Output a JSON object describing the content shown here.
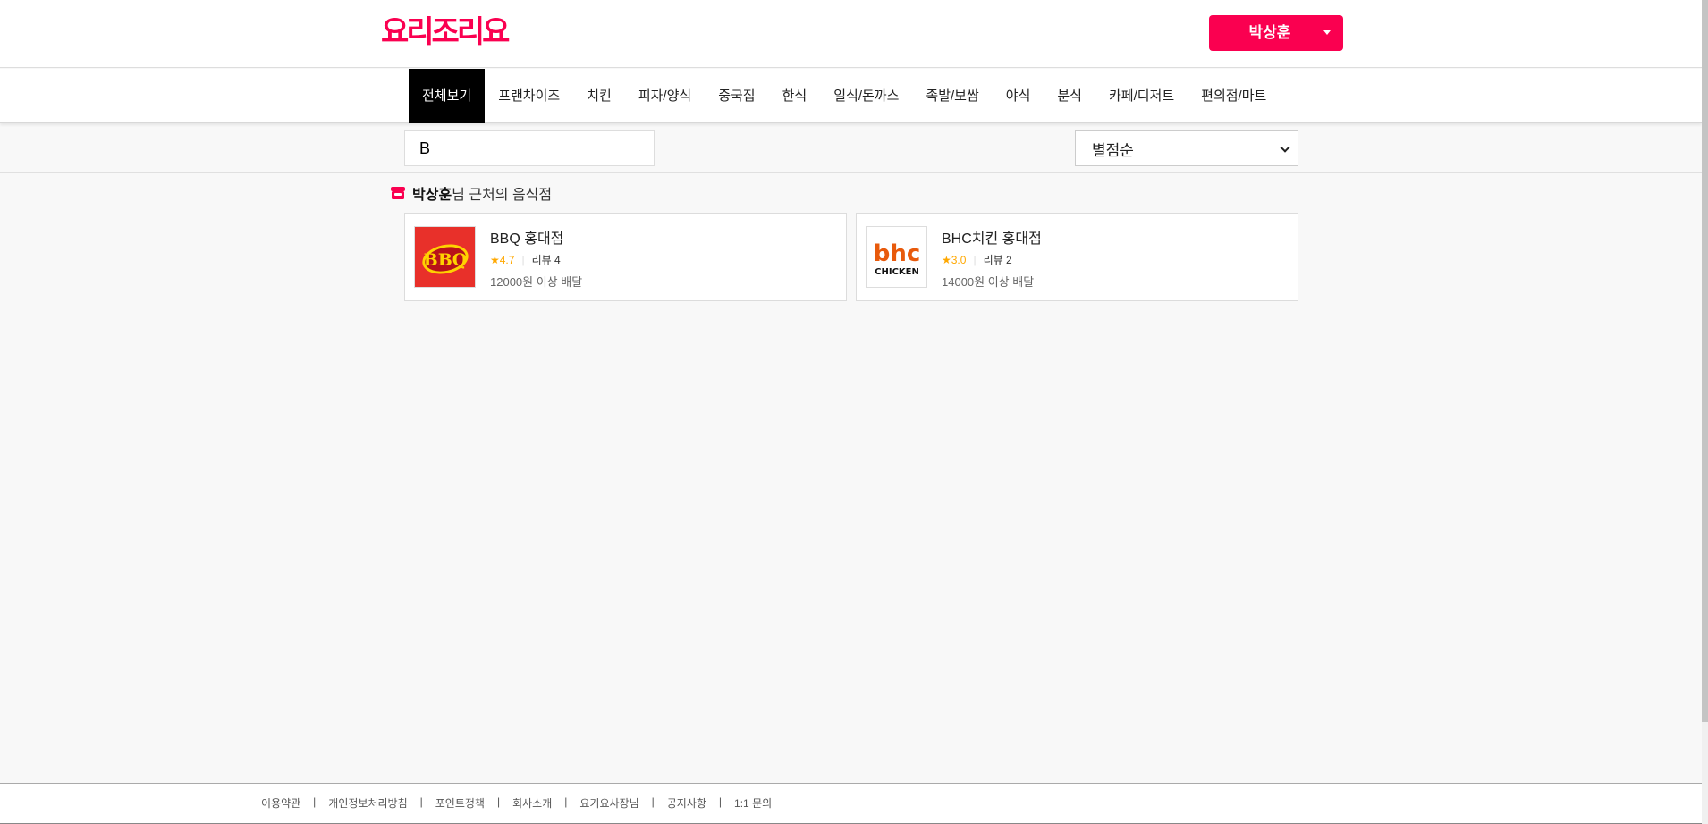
{
  "header": {
    "logo_text": "요리조리요",
    "user_name": "박상훈"
  },
  "nav": {
    "items": [
      "전체보기",
      "프랜차이즈",
      "치킨",
      "피자/양식",
      "중국집",
      "한식",
      "일식/돈까스",
      "족발/보쌈",
      "야식",
      "분식",
      "카페/디저트",
      "편의점/마트"
    ],
    "active_index": 0
  },
  "search": {
    "value": "B"
  },
  "sort": {
    "selected": "별점순"
  },
  "section": {
    "user_name": "박상훈",
    "suffix": "님 근처의 음식점"
  },
  "restaurants": [
    {
      "name": "BBQ 홍대점",
      "rating": "★4.7",
      "reviews": "리뷰 4",
      "min_order": "12000원 이상 배달",
      "logo": "BBQ"
    },
    {
      "name": "BHC치킨 홍대점",
      "rating": "★3.0",
      "reviews": "리뷰 2",
      "min_order": "14000원 이상 배달",
      "logo_top": "bhc",
      "logo_bottom": "CHICKEN"
    }
  ],
  "footer": {
    "links": [
      "이용약관",
      "개인정보처리방침",
      "포인트정책",
      "회사소개",
      "요기요사장님",
      "공지사항",
      "1:1 문의"
    ]
  },
  "colors": {
    "brand": "#fa0050",
    "star": "#ffa800",
    "active_nav": "#000000"
  }
}
